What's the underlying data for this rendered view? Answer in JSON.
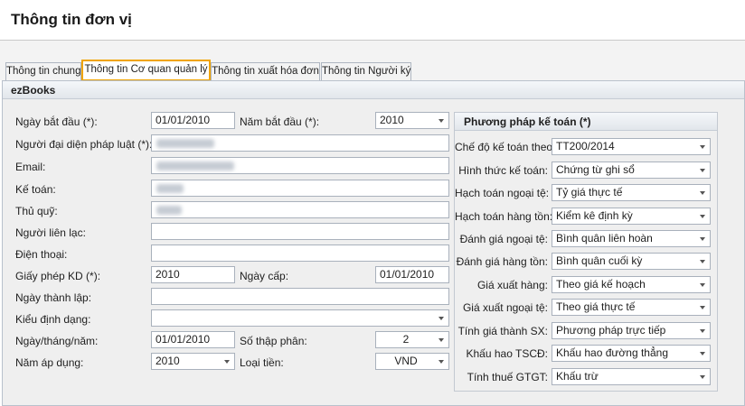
{
  "header": {
    "title": "Thông tin đơn vị"
  },
  "tabs": [
    {
      "label": "Thông tin chung"
    },
    {
      "label": "Thông tin Cơ quan quản lý"
    },
    {
      "label": "Thông tin xuất hóa đơn"
    },
    {
      "label": "Thông tin Người ký"
    }
  ],
  "panel": {
    "title": "ezBooks"
  },
  "form": {
    "start_date_label": "Ngày bắt đầu (*):",
    "start_date_value": "01/01/2010",
    "start_year_label": "Năm bắt đầu (*):",
    "start_year_value": "2010",
    "legal_rep_label": "Người đại diện pháp luật (*):",
    "email_label": "Email:",
    "accountant_label": "Kế toán:",
    "treasurer_label": "Thủ quỹ:",
    "contact_label": "Người liên lạc:",
    "phone_label": "Điện thoại:",
    "license_label": "Giấy phép KD (*):",
    "license_value": "2010",
    "issue_date_label": "Ngày cấp:",
    "issue_date_value": "01/01/2010",
    "founding_date_label": "Ngày thành lập:",
    "format_type_label": "Kiểu định dạng:",
    "date_format_label": "Ngày/tháng/năm:",
    "date_format_value": "01/01/2010",
    "decimals_label": "Số thập phân:",
    "decimals_value": "2",
    "apply_year_label": "Năm áp dụng:",
    "apply_year_value": "2010",
    "currency_label": "Loại tiền:",
    "currency_value": "VND"
  },
  "accounting": {
    "title": "Phương pháp kế toán (*)",
    "rows": [
      {
        "label": "Chế độ kế toán theo:",
        "value": "TT200/2014"
      },
      {
        "label": "Hình thức kế toán:",
        "value": "Chứng từ ghi sổ"
      },
      {
        "label": "Hạch toán ngoại tệ:",
        "value": "Tỷ giá thực tế"
      },
      {
        "label": "Hạch toán hàng tồn:",
        "value": "Kiểm kê định kỳ"
      },
      {
        "label": "Đánh giá ngoại tệ:",
        "value": "Bình quân liên hoàn"
      },
      {
        "label": "Đánh giá hàng tồn:",
        "value": "Bình quân cuối kỳ"
      },
      {
        "label": "Giá xuất hàng:",
        "value": "Theo giá kế hoạch"
      },
      {
        "label": "Giá xuất ngoại tệ:",
        "value": "Theo giá thực tế"
      },
      {
        "label": "Tính giá thành SX:",
        "value": "Phương pháp trực tiếp"
      },
      {
        "label": "Khấu hao TSCĐ:",
        "value": "Khấu hao đường thẳng"
      },
      {
        "label": "Tính thuế GTGT:",
        "value": "Khấu trừ"
      }
    ]
  }
}
